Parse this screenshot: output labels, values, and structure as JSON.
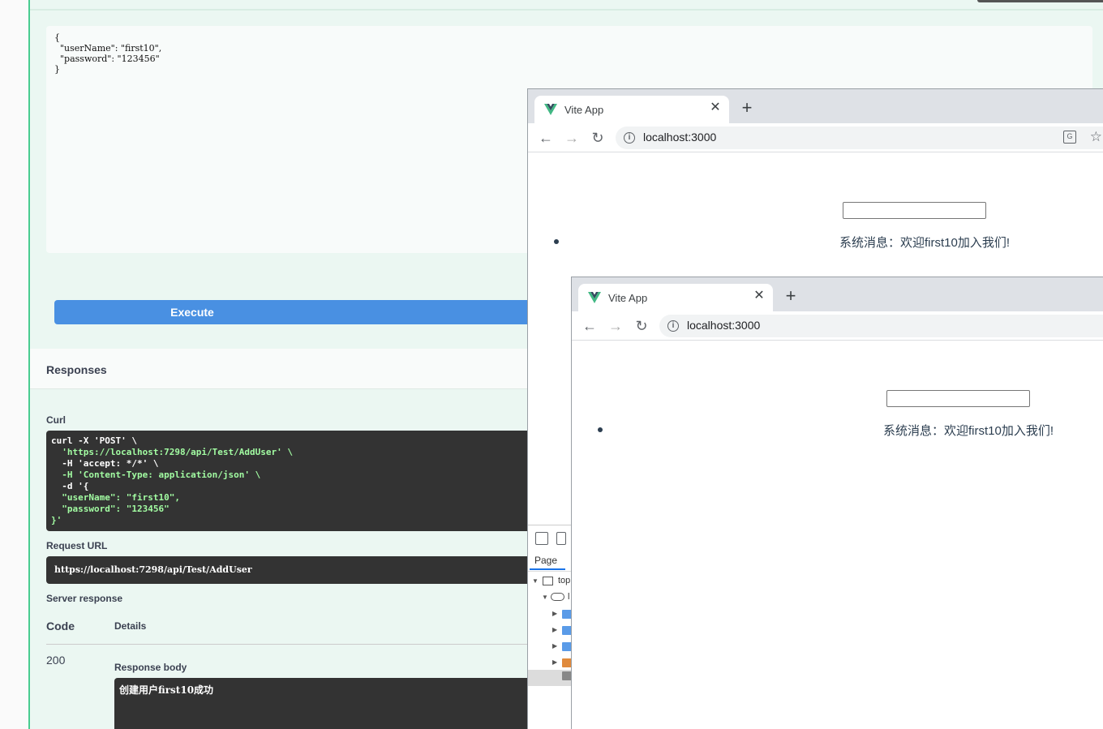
{
  "swagger": {
    "request_body": "{\n  \"userName\": \"first10\",\n  \"password\": \"123456\"\n}",
    "execute_label": "Execute",
    "responses_title": "Responses",
    "curl_label": "Curl",
    "curl_lines": [
      "curl -X 'POST' \\",
      "  'https://localhost:7298/api/Test/AddUser' \\",
      "  -H 'accept: */*' \\",
      "  -H 'Content-Type: application/json' \\",
      "  -d '{",
      "  \"userName\": \"first10\",",
      "  \"password\": \"123456\"",
      "}'"
    ],
    "request_url_label": "Request URL",
    "request_url": "https://localhost:7298/api/Test/AddUser",
    "server_response_label": "Server response",
    "code_header": "Code",
    "details_header": "Details",
    "status_code": "200",
    "response_body_label": "Response body",
    "response_body": "创建用户first10成功"
  },
  "browser1": {
    "tab_title": "Vite App",
    "url": "localhost:3000",
    "message": "系统消息：欢迎first10加入我们!"
  },
  "browser2": {
    "tab_title": "Vite App",
    "url": "localhost:3000",
    "message": "系统消息：欢迎first10加入我们!"
  },
  "devtools": {
    "tab_label": "Page",
    "tree_top": "top",
    "tree_child": "l"
  },
  "colors": {
    "post_green": "#49cc90",
    "execute_blue": "#4990e2",
    "vue_green": "#41b883",
    "vue_dark": "#34495e"
  }
}
